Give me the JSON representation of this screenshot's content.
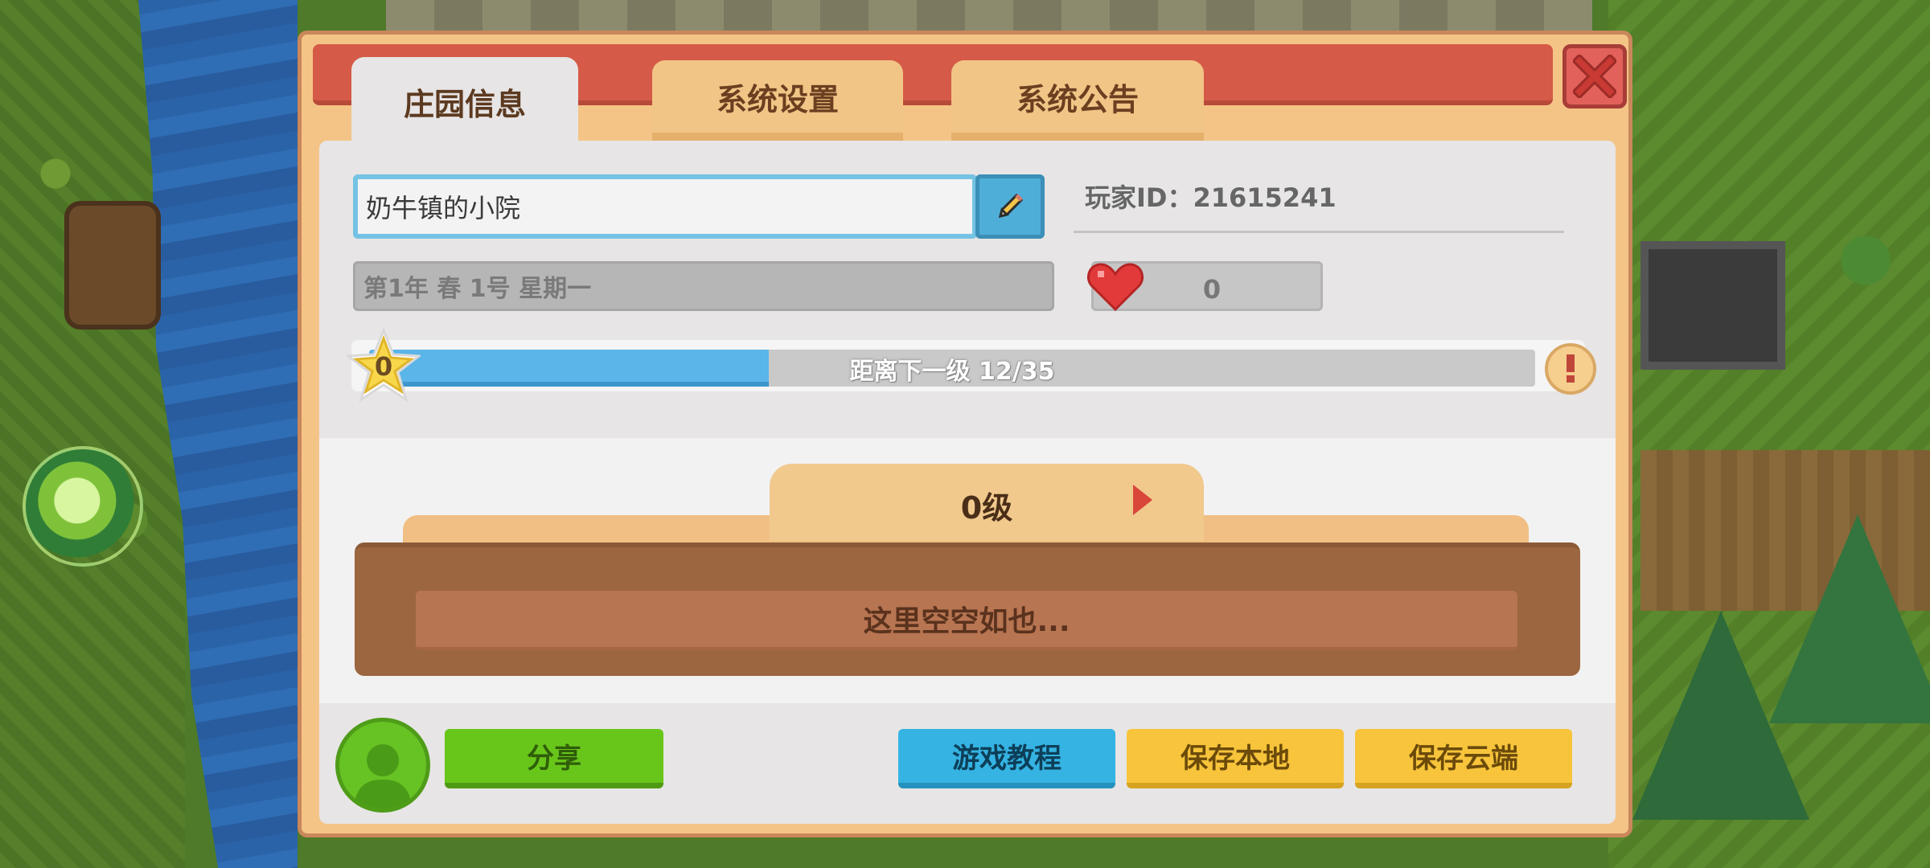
{
  "dialog": {
    "tabs": [
      {
        "label": "庄园信息",
        "active": true
      },
      {
        "label": "系统设置",
        "active": false
      },
      {
        "label": "系统公告",
        "active": false
      }
    ],
    "close_icon": "close-x-icon"
  },
  "estate": {
    "name": "奶牛镇的小院",
    "player_id": "玩家ID：21615241",
    "date": "第1年  春  1号 星期一",
    "likes": "0"
  },
  "progress": {
    "level": "0",
    "text": "距离下一级   12/35",
    "current": 12,
    "total": 35
  },
  "level_panel": {
    "level_label": "0级",
    "empty_text": "这里空空如也..."
  },
  "buttons": {
    "share": "分享",
    "tutorial": "游戏教程",
    "save_local": "保存本地",
    "save_cloud": "保存云端"
  },
  "colors": {
    "title_bar": "#d55a47",
    "dialog_frame": "#f4c487",
    "progress_fill": "#5ab5e9",
    "share_button": "#68c61a",
    "tutorial_button": "#35b3e2",
    "save_button": "#f7c43b"
  }
}
